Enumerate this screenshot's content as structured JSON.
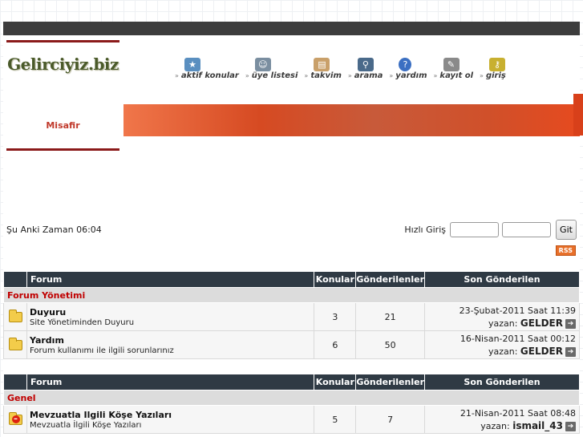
{
  "header": {
    "logo": "Gelirciyiz.biz",
    "guest": "Misafir"
  },
  "nav": [
    {
      "label": "aktif konular",
      "icon": "active-topics-icon"
    },
    {
      "label": "üye listesi",
      "icon": "members-icon"
    },
    {
      "label": "takvim",
      "icon": "calendar-icon"
    },
    {
      "label": "arama",
      "icon": "search-icon"
    },
    {
      "label": "yardım",
      "icon": "help-icon"
    },
    {
      "label": "kayıt ol",
      "icon": "register-icon"
    },
    {
      "label": "giriş",
      "icon": "login-icon"
    }
  ],
  "status": {
    "time_text": "Şu Anki Zaman 06:04"
  },
  "login": {
    "label": "Hızlı Giriş",
    "username_value": "",
    "password_value": "",
    "button": "Git"
  },
  "rss": "RSS",
  "tables": [
    {
      "headers": {
        "forum": "Forum",
        "topics": "Konular",
        "posts": "Gönderilenler",
        "last": "Son Gönderilen"
      },
      "category": "Forum Yönetimi",
      "rows": [
        {
          "title": "Duyuru",
          "desc": "Site Yönetiminden Duyuru",
          "topics": "3",
          "posts": "21",
          "last_date": "23-Şubat-2011 Saat 11:39",
          "by_label": "yazan:",
          "last_user": "GELDER"
        },
        {
          "title": "Yardım",
          "desc": "Forum kullanımı ile ilgili sorunlarınız",
          "topics": "6",
          "posts": "50",
          "last_date": "16-Nisan-2011 Saat 00:12",
          "by_label": "yazan:",
          "last_user": "GELDER"
        }
      ]
    },
    {
      "headers": {
        "forum": "Forum",
        "topics": "Konular",
        "posts": "Gönderilenler",
        "last": "Son Gönderilen"
      },
      "category": "Genel",
      "rows": [
        {
          "title": "Mevzuatla Ilgili Köşe Yazıları",
          "desc": "Mevzuatla İlgili Köşe Yazıları",
          "topics": "5",
          "posts": "7",
          "last_date": "21-Nisan-2011 Saat 08:48",
          "by_label": "yazan:",
          "last_user": "ismail_43"
        }
      ]
    }
  ],
  "colors": {
    "topbar": "#3d3d3d",
    "accent_dark_red": "#8b1a1a",
    "table_header": "#2f3a44",
    "category_text": "#c00000",
    "banner": "#d64a22"
  }
}
